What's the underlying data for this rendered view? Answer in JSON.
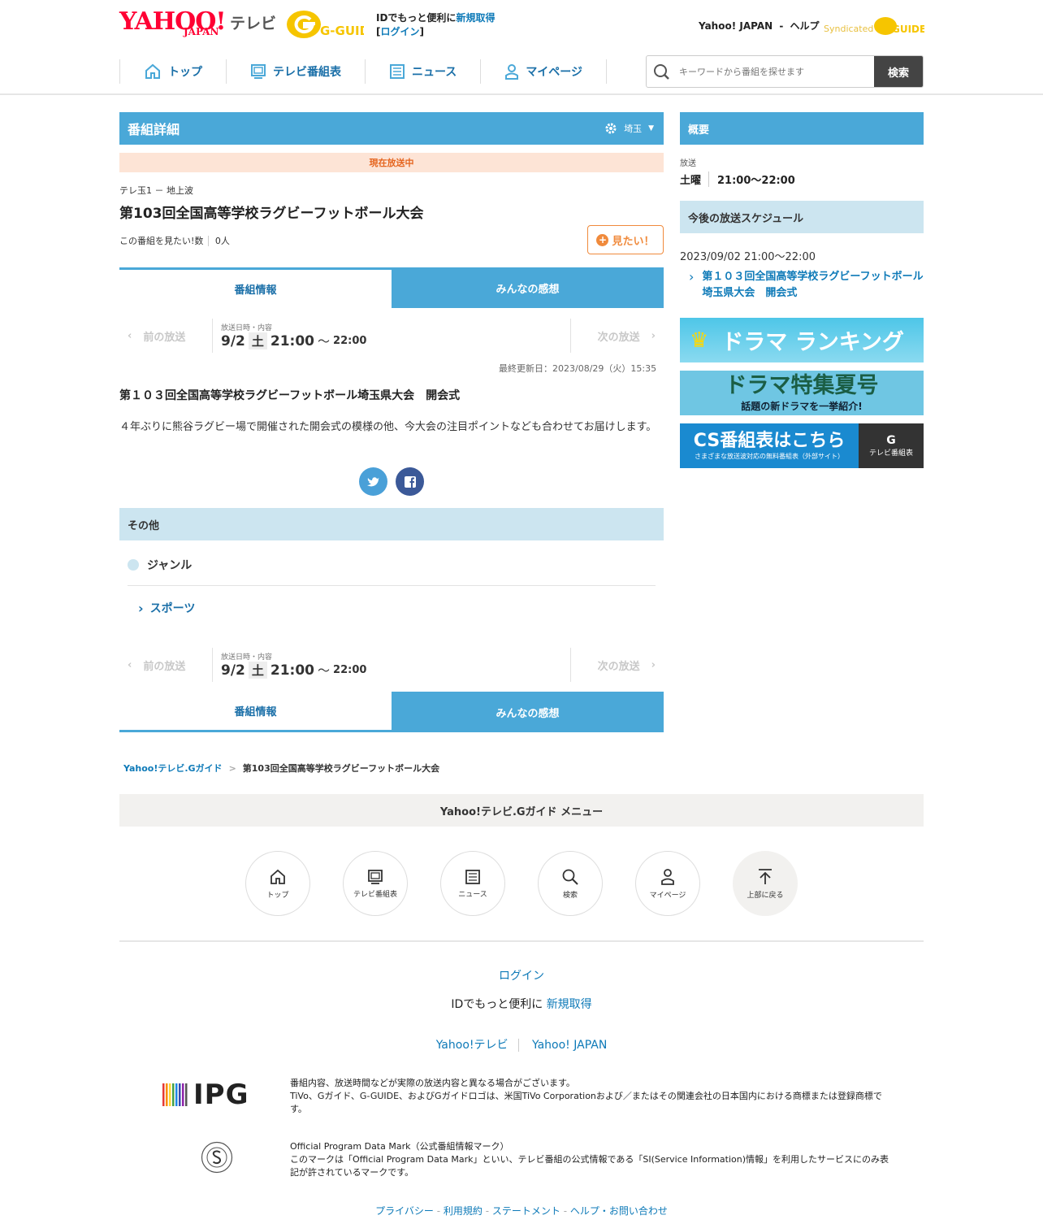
{
  "header": {
    "logo_yahoo": "YAHOO!",
    "logo_japan": "JAPAN",
    "logo_tv": "テレビ",
    "gguide_logo": "G-GUIDE",
    "id_promo": "IDでもっと便利に",
    "signup": "新規取得",
    "login": "ログイン",
    "yahoo_japan": "Yahoo! JAPAN",
    "sep": "-",
    "help": "ヘルプ",
    "syndicated": "Syndicated",
    "synd_logo": "GUIDE"
  },
  "nav": [
    {
      "label": "トップ",
      "icon": "home-icon"
    },
    {
      "label": "テレビ番組表",
      "icon": "tv-icon"
    },
    {
      "label": "ニュース",
      "icon": "news-icon"
    },
    {
      "label": "マイページ",
      "icon": "user-icon"
    }
  ],
  "search": {
    "placeholder": "キーワードから番組を探せます",
    "button": "検索"
  },
  "detail": {
    "heading": "番組詳細",
    "region": "埼玉",
    "onair": "現在放送中",
    "channel": "テレ玉1",
    "channel_sep": "－",
    "channel_type": "地上波",
    "title": "第103回全国高等学校ラグビーフットボール大会",
    "want_count_label": "この番組を見たい!数",
    "want_count": "0人",
    "want_button": "見たい！",
    "tab_info": "番組情報",
    "tab_reviews": "みんなの感想",
    "prev": "前の放送",
    "next": "次の放送",
    "bcast_label": "放送日時・内容",
    "date": "9/2",
    "dow": "土",
    "start": "21:00",
    "tilde": "〜",
    "end": "22:00",
    "updated": "最終更新日：2023/08/29（火）15:35",
    "subtitle": "第１０３回全国高等学校ラグビーフットボール埼玉県大会　開会式",
    "description": "４年ぶりに熊谷ラグビー場で開催された開会式の模様の他、今大会の注目ポイントなども合わせてお届けします。",
    "other_heading": "その他",
    "genre_label": "ジャンル",
    "genre": "スポーツ"
  },
  "sidebar": {
    "overview": "概要",
    "broadcast_label": "放送",
    "day": "土曜",
    "time": "21:00〜22:00",
    "schedule_heading": "今後の放送スケジュール",
    "schedule_date": "2023/09/02 21:00〜22:00",
    "schedule_title": "第１０３回全国高等学校ラグビーフットボール埼玉県大会　開会式",
    "banner1": "ドラマ ランキング",
    "banner2_title": "ドラマ特集夏号",
    "banner2_sub": "話題の新ドラマを一挙紹介!",
    "banner3_title": "CS番組表はこちら",
    "banner3_sub": "さまざまな放送波対応の無料番組表（外部サイト）",
    "banner3_right": "テレビ番組表"
  },
  "breadcrumb": {
    "home": "Yahoo!テレビ.Gガイド",
    "sep": ">",
    "current": "第103回全国高等学校ラグビーフットボール大会"
  },
  "footer": {
    "menu_heading": "Yahoo!テレビ.Gガイド メニュー",
    "menu": [
      {
        "label": "トップ",
        "icon": "home-icon"
      },
      {
        "label": "テレビ番組表",
        "icon": "tv-icon"
      },
      {
        "label": "ニュース",
        "icon": "news-icon"
      },
      {
        "label": "検索",
        "icon": "search-icon"
      },
      {
        "label": "マイページ",
        "icon": "user-icon"
      },
      {
        "label": "上部に戻る",
        "icon": "back-to-top-icon"
      }
    ],
    "login": "ログイン",
    "id_promo": "IDでもっと便利に",
    "signup": "新規取得",
    "yahoo_tv": "Yahoo!テレビ",
    "yahoo_japan": "Yahoo! JAPAN",
    "ipg_logo": "IPG",
    "note1": "番組内容、放送時間などが実際の放送内容と異なる場合がございます。",
    "note2": "TiVo、Gガイド、G-GUIDE、およびGガイドロゴは、米国TiVo Corporationおよび／またはその関連会社の日本国内における商標または登録商標です。",
    "opdm_title": "Official Program Data Mark（公式番組情報マーク）",
    "opdm_text": "このマークは「Official Program Data Mark」といい、テレビ番組の公式情報である「SI(Service Information)情報」を利用したサービスにのみ表記が許されているマークです。",
    "links": [
      "プライバシー",
      "利用規約",
      "ステートメント",
      "ヘルプ・お問い合わせ"
    ],
    "link_sep": "-"
  },
  "colors": {
    "accent": "#4aa8d8",
    "light": "#cce5f0",
    "orange": "#f08a3c",
    "link": "#0e7ab8"
  }
}
